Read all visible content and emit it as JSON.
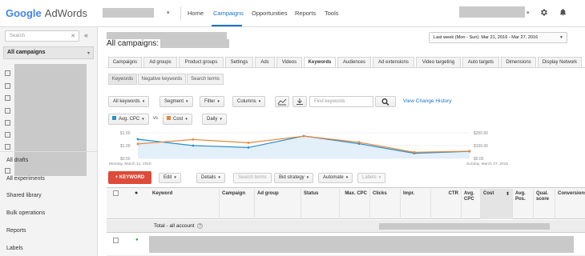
{
  "header": {
    "logo_google": "Google",
    "logo_adwords": "AdWords",
    "nav": [
      "Home",
      "Campaigns",
      "Opportunities",
      "Reports",
      "Tools"
    ],
    "dropdown_caret": "▾"
  },
  "sidebar": {
    "search_placeholder": "Search",
    "collapse": "«",
    "campaigns_label": "All campaigns",
    "bottom_items": [
      "All drafts",
      "All experiments",
      "Shared library",
      "Bulk operations",
      "Reports",
      "Labels"
    ]
  },
  "main": {
    "title": "All campaigns:",
    "date_range": "Last week (Mon - Sun): Mar 21, 2016 - Mar 27, 2016",
    "tabs": [
      "Campaigns",
      "Ad groups",
      "Product groups",
      "Settings",
      "Ads",
      "Videos",
      "Keywords",
      "Audiences",
      "Ad extensions",
      "Video targeting",
      "Auto targets",
      "Dimensions",
      "Display Network"
    ],
    "active_tab": "Keywords",
    "subtabs": [
      "Keywords",
      "Negative keywords",
      "Search terms"
    ],
    "filter_bar": {
      "all_keywords": "All keywords",
      "segment": "Segment",
      "filter": "Filter",
      "columns": "Columns",
      "search_placeholder": "Find keywords",
      "view_change_history": "View Change History"
    },
    "metrics": {
      "metric1": "Avg. CPC",
      "vs": "vs",
      "metric2": "Cost",
      "period": "Daily"
    },
    "actions": {
      "add_keyword": "+ KEYWORD",
      "edit": "Edit",
      "details": "Details",
      "search_terms": "Search terms",
      "bid_strategy": "Bid strategy",
      "automate": "Automate",
      "labels": "Labels"
    },
    "table": {
      "headers": [
        "Keyword",
        "Campaign",
        "Ad group",
        "Status",
        "Max. CPC",
        "Clicks",
        "Impr.",
        "CTR",
        "Avg. CPC",
        "Cost",
        "Avg. Pos.",
        "Qual. score",
        "Conversions"
      ],
      "total_label": "Total - all account"
    }
  },
  "chart_data": {
    "type": "line",
    "x": [
      "Monday, March 21, 2016",
      "",
      "",
      "",
      "",
      "",
      "Sunday, March 27, 2016"
    ],
    "series": [
      {
        "name": "Avg. CPC",
        "color": "#2b8fd0",
        "values": [
          1.5,
          1.0,
          0.85,
          1.75,
          1.15,
          0.4,
          0.55
        ]
      },
      {
        "name": "Cost",
        "color": "#e8873a",
        "values": [
          130,
          170,
          140,
          200,
          145,
          55,
          65
        ]
      }
    ],
    "y_left_ticks": [
      "$1.50",
      "$1.00",
      "$0.50"
    ],
    "y_right_ticks": [
      "$200.00",
      "$100.00",
      "$0.00"
    ],
    "x_start_label": "Monday, March 21, 2016",
    "x_end_label": "Sunday, March 27, 2016"
  },
  "colors": {
    "accent": "#1a73c9",
    "red_button": "#dd4b39",
    "series_blue": "#2b8fd0",
    "series_orange": "#e8873a"
  }
}
